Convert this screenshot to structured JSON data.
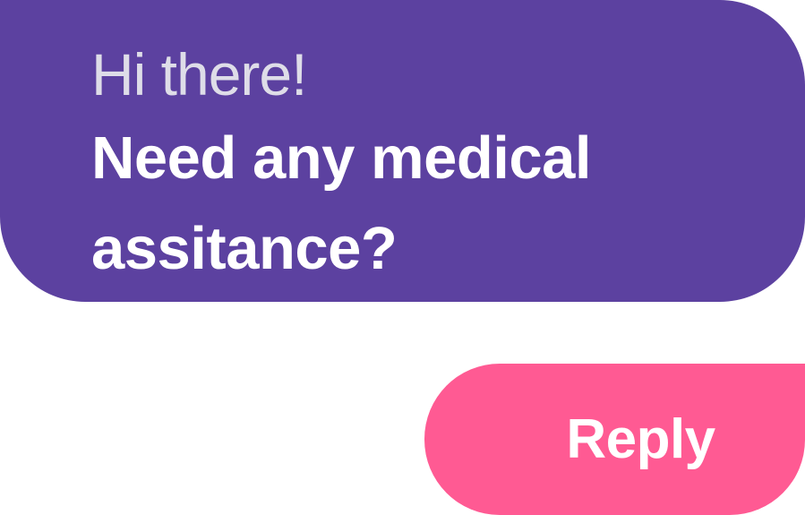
{
  "message": {
    "greeting": "Hi there!",
    "question": "Need any medical assitance?"
  },
  "reply": {
    "label": "Reply"
  },
  "colors": {
    "background": "#ffffff",
    "message_bubble": "#5c41a0",
    "greeting_text": "#dedde8",
    "question_text": "#ffffff",
    "reply_button": "#ff5a93",
    "reply_text": "#ffffff"
  }
}
